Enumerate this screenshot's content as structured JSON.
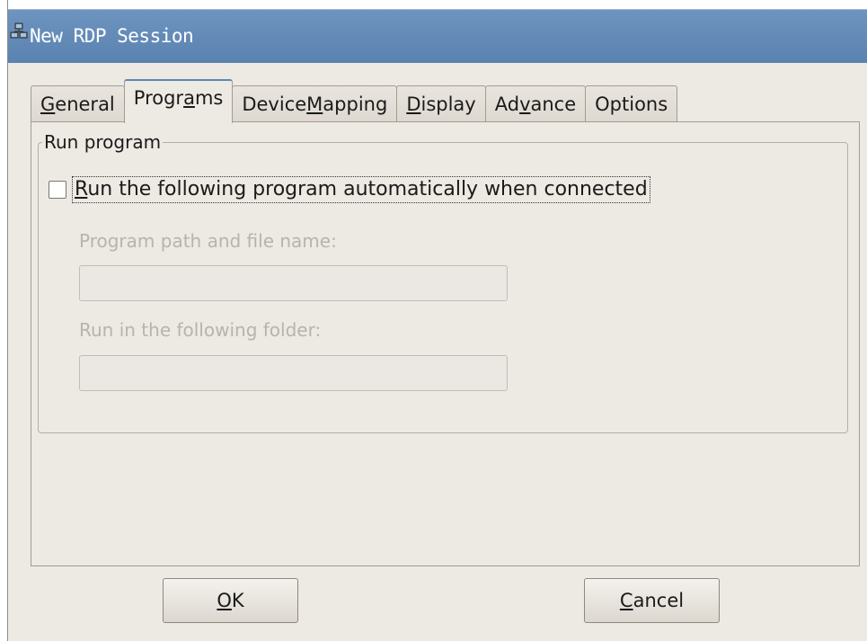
{
  "window": {
    "title": "New RDP Session",
    "icon": "network-computers-icon"
  },
  "tabs": [
    {
      "pre": "",
      "key": "G",
      "post": "eneral",
      "active": false
    },
    {
      "pre": "Progr",
      "key": "a",
      "post": "ms",
      "active": true
    },
    {
      "pre": "Device ",
      "key": "M",
      "post": "apping",
      "active": false
    },
    {
      "pre": "",
      "key": "D",
      "post": "isplay",
      "active": false
    },
    {
      "pre": "Ad",
      "key": "v",
      "post": "ance",
      "active": false
    },
    {
      "pre": "Options",
      "key": "",
      "post": "",
      "active": false
    }
  ],
  "group": {
    "title": "Run program",
    "checkbox": {
      "checked": false,
      "key": "R",
      "rest": "un the following program automatically when connected"
    },
    "program_path_label": "Program path and file name:",
    "program_path_value": "",
    "folder_label": "Run in the following folder:",
    "folder_value": ""
  },
  "buttons": {
    "ok": {
      "key": "O",
      "rest": "K"
    },
    "cancel": {
      "key": "C",
      "rest": "ancel"
    }
  }
}
